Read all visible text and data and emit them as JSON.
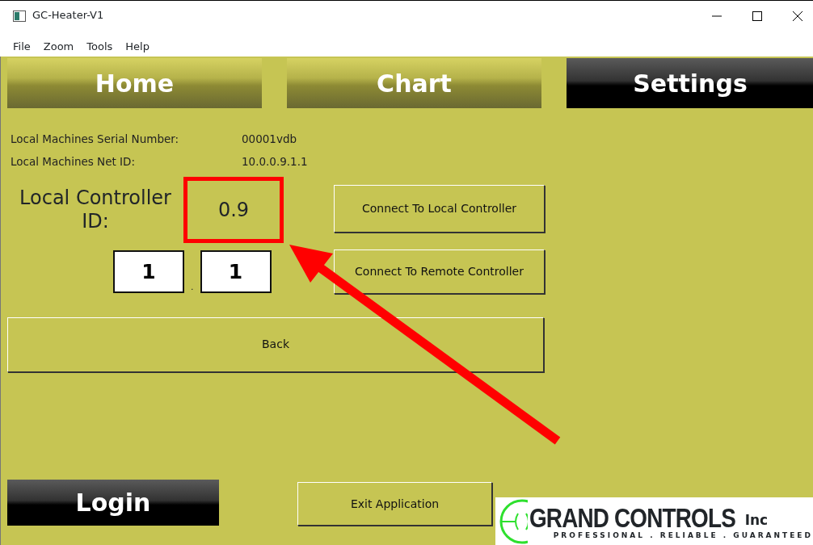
{
  "window": {
    "title": "GC-Heater-V1"
  },
  "menu": [
    "File",
    "Zoom",
    "Tools",
    "Help"
  ],
  "tabs": [
    {
      "label": "Home",
      "selected": false
    },
    {
      "label": "Chart",
      "selected": false
    },
    {
      "label": "Settings",
      "selected": true
    }
  ],
  "info": [
    {
      "label": "Local Machines Serial Number:",
      "value": "00001vdb"
    },
    {
      "label": "Local Machines Net ID:",
      "value": "10.0.0.9.1.1"
    }
  ],
  "controller": {
    "label": "Local Controller ID:",
    "value": "0.9"
  },
  "id_fields": [
    {
      "value": "1"
    },
    {
      "value": "1"
    }
  ],
  "id_separator": ".",
  "connect_buttons": [
    "Connect To Local Controller",
    "Connect To Remote Controller"
  ],
  "back_button": "Back",
  "login_button": "Login",
  "exit_button": "Exit Application",
  "logo": {
    "name": "GRAND CONTROLS",
    "suffix": "Inc",
    "tagline": "PROFESSIONAL . RELIABLE . GUARANTEED"
  }
}
